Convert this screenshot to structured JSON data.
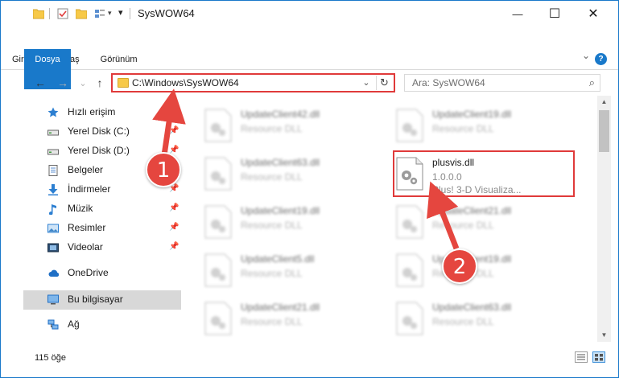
{
  "window": {
    "title": "SysWOW64"
  },
  "caption": {
    "minimize": "—",
    "maximize": "☐",
    "close": "✕"
  },
  "ribbon": {
    "tabs": [
      "Dosya",
      "Giriş",
      "Paylaş",
      "Görünüm"
    ],
    "collapse_glyph": "⌄",
    "help_glyph": "?"
  },
  "nav": {
    "back": "←",
    "forward": "→",
    "recent": "⌄",
    "up": "↑"
  },
  "address": {
    "path": "C:\\Windows\\SysWOW64",
    "dropdown": "⌄",
    "refresh": "↻"
  },
  "search": {
    "placeholder": "Ara: SysWOW64",
    "icon": "⌕"
  },
  "sidebar": {
    "items": [
      {
        "label": "Hızlı erişim",
        "icon": "star-icon",
        "pinned": false
      },
      {
        "label": "Yerel Disk (C:)",
        "icon": "drive-icon",
        "pinned": true
      },
      {
        "label": "Yerel Disk (D:)",
        "icon": "drive-icon",
        "pinned": true
      },
      {
        "label": "Belgeler",
        "icon": "documents-icon",
        "pinned": true
      },
      {
        "label": "İndirmeler",
        "icon": "download-icon",
        "pinned": true
      },
      {
        "label": "Müzik",
        "icon": "music-icon",
        "pinned": true
      },
      {
        "label": "Resimler",
        "icon": "pictures-icon",
        "pinned": true
      },
      {
        "label": "Videolar",
        "icon": "videos-icon",
        "pinned": true
      },
      {
        "label": "OneDrive",
        "icon": "cloud-icon",
        "pinned": false
      },
      {
        "label": "Bu bilgisayar",
        "icon": "computer-icon",
        "pinned": false,
        "selected": true
      },
      {
        "label": "Ağ",
        "icon": "network-icon",
        "pinned": false
      }
    ],
    "pin_glyph": "📌"
  },
  "files": [
    {
      "name": "UpdateClient42.dll",
      "desc": "Resource DLL",
      "blurred": true
    },
    {
      "name": "UpdateClient19.dll",
      "desc": "Resource DLL",
      "blurred": true
    },
    {
      "name": "UpdateClient63.dll",
      "desc": "Resource DLL",
      "blurred": true
    },
    {
      "name": "plusvis.dll",
      "version": "1.0.0.0",
      "desc": "Plus! 3-D Visualiza...",
      "blurred": false
    },
    {
      "name": "UpdateClient19.dll",
      "desc": "Resource DLL",
      "blurred": true
    },
    {
      "name": "UpdateClient21.dll",
      "desc": "Resource DLL",
      "blurred": true
    },
    {
      "name": "UpdateClient5.dll",
      "desc": "Resource DLL",
      "blurred": true
    },
    {
      "name": "UpdateClient19.dll",
      "desc": "Resource DLL",
      "blurred": true
    },
    {
      "name": "UpdateClient21.dll",
      "desc": "Resource DLL",
      "blurred": true
    },
    {
      "name": "UpdateClient63.dll",
      "desc": "Resource DLL",
      "blurred": true
    }
  ],
  "status": {
    "count": "115 öğe"
  },
  "callouts": [
    "1",
    "2"
  ],
  "colors": {
    "accent": "#1979ca",
    "highlight": "#e03a3a",
    "callout": "#e5463f"
  }
}
